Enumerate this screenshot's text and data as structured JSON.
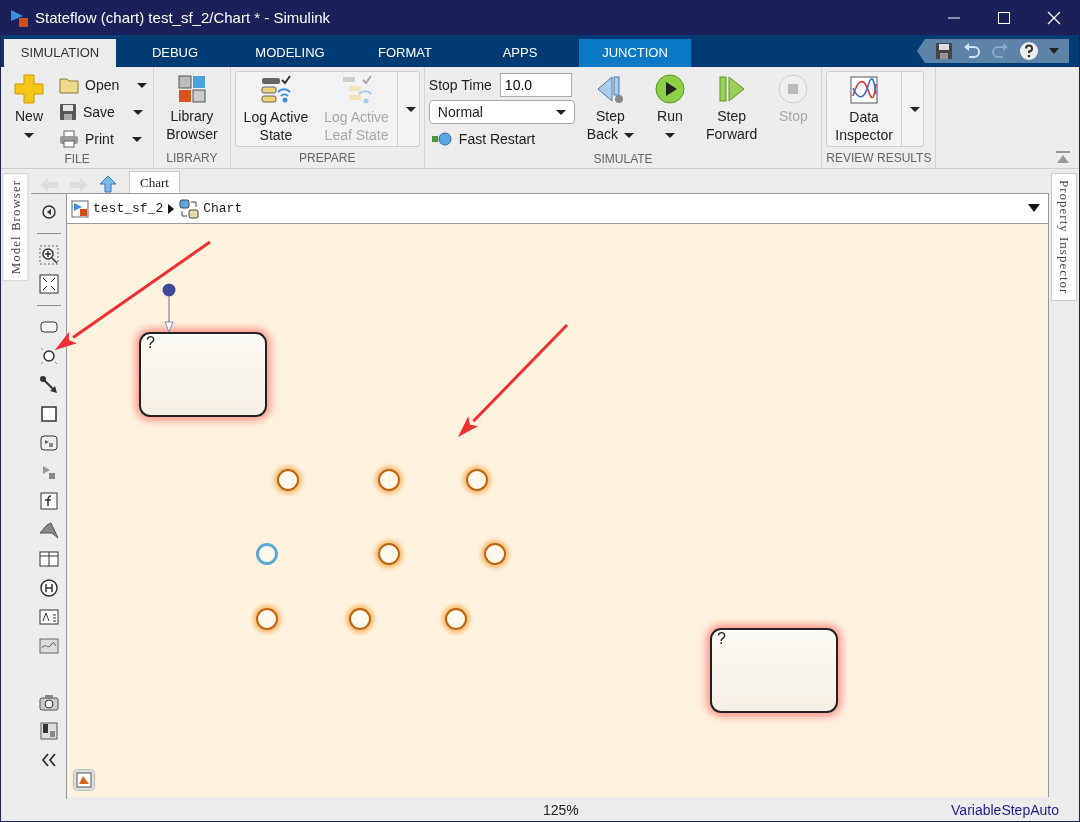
{
  "window": {
    "title": "Stateflow (chart) test_sf_2/Chart * - Simulink"
  },
  "tabs": [
    {
      "label": "SIMULATION",
      "selected": true,
      "kind": "standard"
    },
    {
      "label": "DEBUG",
      "selected": false,
      "kind": "standard"
    },
    {
      "label": "MODELING",
      "selected": false,
      "kind": "standard"
    },
    {
      "label": "FORMAT",
      "selected": false,
      "kind": "standard"
    },
    {
      "label": "APPS",
      "selected": false,
      "kind": "standard"
    },
    {
      "label": "JUNCTION",
      "selected": false,
      "kind": "contextual"
    }
  ],
  "ribbon": {
    "groups": [
      {
        "title": "FILE",
        "kind": "plain",
        "items": [
          {
            "kind": "large",
            "lines": [
              "New"
            ],
            "caret": true,
            "disabled": false
          },
          {
            "kind": "small",
            "label": "Open",
            "caret": true
          },
          {
            "kind": "small",
            "label": "Save",
            "caret": true
          },
          {
            "kind": "small",
            "label": "Print",
            "caret": true
          }
        ]
      },
      {
        "title": "LIBRARY",
        "kind": "plain",
        "items": [
          {
            "kind": "large",
            "lines": [
              "Library",
              "Browser"
            ],
            "caret": false,
            "disabled": false
          }
        ]
      },
      {
        "title": "PREPARE",
        "kind": "gallery",
        "items": [
          {
            "kind": "large",
            "lines": [
              "Log Active",
              "State"
            ],
            "caret": false,
            "disabled": false
          },
          {
            "kind": "large",
            "lines": [
              "Log Active",
              "Leaf State"
            ],
            "caret": false,
            "disabled": true
          }
        ]
      },
      {
        "title": "SIMULATE",
        "kind": "plain",
        "items": [
          {
            "kind": "field",
            "label": "Stop Time",
            "value": "10.0"
          },
          {
            "kind": "select",
            "value": "Normal"
          },
          {
            "kind": "small",
            "label": "Fast Restart",
            "caret": false
          },
          {
            "kind": "large",
            "lines": [
              "Step",
              "Back"
            ],
            "caret": true,
            "disabled": false
          },
          {
            "kind": "large",
            "lines": [
              "Run"
            ],
            "caret": true,
            "disabled": false
          },
          {
            "kind": "large",
            "lines": [
              "Step",
              "Forward"
            ],
            "caret": false,
            "disabled": false
          },
          {
            "kind": "large",
            "lines": [
              "Stop"
            ],
            "caret": false,
            "disabled": true
          }
        ]
      },
      {
        "title": "REVIEW RESULTS",
        "kind": "gallery",
        "items": [
          {
            "kind": "large",
            "lines": [
              "Data",
              "Inspector"
            ],
            "caret": false,
            "disabled": false
          }
        ]
      }
    ]
  },
  "side_tabs": {
    "left": "Model Browser",
    "right": "Property Inspector"
  },
  "editor_tab": {
    "label": "Chart"
  },
  "breadcrumb": [
    "test_sf_2",
    "Chart"
  ],
  "chart": {
    "states": [
      {
        "label": "?"
      },
      {
        "label": "?"
      }
    ],
    "junctions": [
      {
        "selected": false
      },
      {
        "selected": false
      },
      {
        "selected": false
      },
      {
        "selected": true
      },
      {
        "selected": false
      },
      {
        "selected": false
      },
      {
        "selected": false
      },
      {
        "selected": false
      },
      {
        "selected": false
      }
    ]
  },
  "status_bar": {
    "zoom": "125%",
    "solver": "VariableStepAuto"
  }
}
